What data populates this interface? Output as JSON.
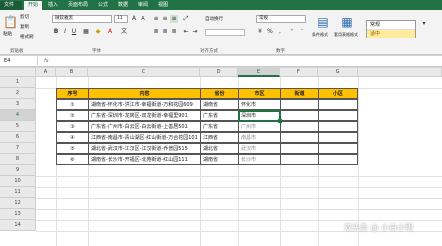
{
  "ribbon": {
    "tabs": [
      "文件",
      "开始",
      "插入",
      "页面布局",
      "公式",
      "数据",
      "审阅",
      "视图"
    ],
    "paste_label": "粘贴",
    "cut_label": "剪切",
    "copy_label": "复制",
    "format_painter_label": "格式刷",
    "font_name": "微软雅黑",
    "font_size": "11",
    "wrap_label": "自动换行",
    "number_format": "常规",
    "cond_format_label": "条件格式",
    "table_format_label": "套用表格格式",
    "groups": {
      "clipboard": "剪贴板",
      "font": "字体",
      "align": "对齐方式",
      "number": "数字"
    },
    "styles": {
      "normal": "常规",
      "neutral": "适中"
    }
  },
  "formula_bar": {
    "name_box": "E4",
    "fx": "fx"
  },
  "columns": [
    "A",
    "B",
    "C",
    "D",
    "E",
    "F",
    "G"
  ],
  "rows": [
    "1",
    "2",
    "3",
    "4",
    "5",
    "6",
    "7",
    "8",
    "9",
    "10",
    "11",
    "12",
    "13",
    "14"
  ],
  "table": {
    "headers": [
      "序号",
      "内容",
      "省份",
      "市区",
      "街道",
      "小区"
    ],
    "rows": [
      [
        "①",
        "湖南省-怀化市-洪江市-幸福街道-万和花园609",
        "湖南省",
        "怀化市",
        "",
        ""
      ],
      [
        "②",
        "广东省-深圳市-龙岗区-双龙街道-幸福里901",
        "广东省",
        "深圳市",
        "",
        ""
      ],
      [
        "③",
        "广东省-广州市-白云区-白云街道-上善居501",
        "广东省",
        "广州市",
        "",
        ""
      ],
      [
        "④",
        "江西省-南昌市-青山湖区-红山街道-万合花园101",
        "江西省",
        "南昌市",
        "",
        ""
      ],
      [
        "⑤",
        "湖北省-武汉市-江汉区-江汉街道-乔普园515",
        "湖北省",
        "武汉市",
        "",
        ""
      ],
      [
        "⑥",
        "湖南省-长沙市-开福区-北苑街道-红山园111",
        "湖南省",
        "长沙市",
        "",
        ""
      ]
    ]
  },
  "watermark": "双头条 @ 小白小明"
}
